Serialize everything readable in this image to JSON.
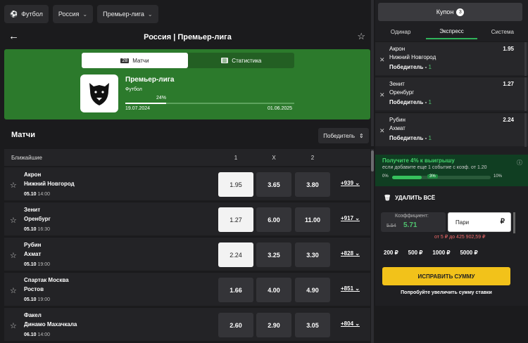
{
  "breadcrumbs": [
    {
      "label": "Футбол",
      "icon": "soccer-ball-icon"
    },
    {
      "label": "Россия"
    },
    {
      "label": "Премьер-лига"
    }
  ],
  "header": {
    "title": "Россия | Премьер-лига"
  },
  "banner": {
    "tabs": [
      {
        "label": "Матчи",
        "icon": "matches-icon",
        "active": true
      },
      {
        "label": "Статистика",
        "icon": "stats-icon",
        "active": false
      }
    ],
    "league_name": "Премьер-лига",
    "sport": "Футбол",
    "progress_pct": "24%",
    "progress_value": 0.24,
    "date_start": "19.07.2024",
    "date_end": "01.06.2025"
  },
  "matches_section": {
    "title": "Матчи",
    "sort_label": "Победитель",
    "list_header": {
      "label": "Ближайшие",
      "col1": "1",
      "colx": "X",
      "col2": "2"
    }
  },
  "matches": [
    {
      "team1": "Акрон",
      "team2": "Нижний Новгород",
      "date": "05.10",
      "time": "14:00",
      "odd1": "1.95",
      "oddx": "3.65",
      "odd2": "3.80",
      "more": "+939",
      "selected": "1"
    },
    {
      "team1": "Зенит",
      "team2": "Оренбург",
      "date": "05.10",
      "time": "16:30",
      "odd1": "1.27",
      "oddx": "6.00",
      "odd2": "11.00",
      "more": "+917",
      "selected": "1"
    },
    {
      "team1": "Рубин",
      "team2": "Ахмат",
      "date": "05.10",
      "time": "19:00",
      "odd1": "2.24",
      "oddx": "3.25",
      "odd2": "3.30",
      "more": "+828",
      "selected": "1"
    },
    {
      "team1": "Спартак Москва",
      "team2": "Ростов",
      "date": "05.10",
      "time": "19:00",
      "odd1": "1.66",
      "oddx": "4.00",
      "odd2": "4.90",
      "more": "+851",
      "selected": ""
    },
    {
      "team1": "Факел",
      "team2": "Динамо Махачкала",
      "date": "06.10",
      "time": "14:00",
      "odd1": "2.60",
      "oddx": "2.90",
      "odd2": "3.05",
      "more": "+804",
      "selected": ""
    }
  ],
  "coupon": {
    "title": "Купон",
    "count": "3",
    "tabs": [
      "Одинар",
      "Экспресс",
      "Система"
    ],
    "active_tab": "Экспресс",
    "bets": [
      {
        "team1": "Акрон",
        "team2": "Нижний Новгород",
        "market": "Победитель -",
        "outcome": "1",
        "odd": "1.95"
      },
      {
        "team1": "Зенит",
        "team2": "Оренбург",
        "market": "Победитель -",
        "outcome": "1",
        "odd": "1.27"
      },
      {
        "team1": "Рубин",
        "team2": "Ахмат",
        "market": "Победитель -",
        "outcome": "1",
        "odd": "2.24"
      }
    ],
    "promo": {
      "headline": "Получите 4% к выигрышу",
      "sub": "если добавите еще 1 событие с коэф. от 1.20",
      "min": "0%",
      "max": "10%",
      "current": "3%",
      "value": 0.3
    },
    "delete_all": "УДАЛИТЬ ВСЁ",
    "coef_label": "Коэффициент:",
    "coef_old": "5.54",
    "coef_new": "5.71",
    "stake_placeholder": "Пари",
    "currency": "₽",
    "range_hint": "от 5 ₽ до 425 902,59 ₽",
    "quick_amounts": [
      "200 ₽",
      "500 ₽",
      "1000 ₽",
      "5000 ₽"
    ],
    "fix_button": "ИСПРАВИТЬ СУММУ",
    "fix_hint": "Попробуйте увеличить сумму ставки"
  },
  "colors": {
    "banner_green": "#2c7a2c",
    "accent_green": "#2fb35a",
    "fix_yellow": "#f2c21a",
    "error_red": "#f06a6a"
  }
}
